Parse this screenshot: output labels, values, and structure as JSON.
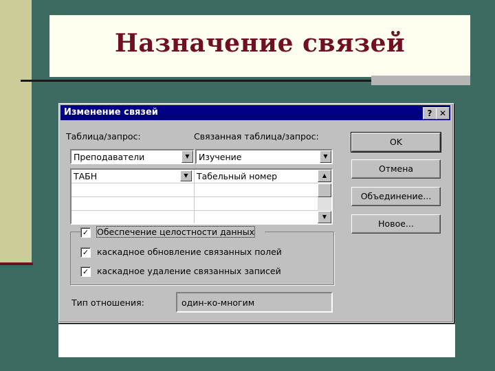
{
  "slide": {
    "title": "Назначение связей"
  },
  "dialog": {
    "title": "Изменение связей",
    "help_button": "?",
    "close_button": "✕",
    "table_label": "Таблица/запрос:",
    "related_table_label": "Связанная таблица/запрос:",
    "table_value": "Преподаватели",
    "related_table_value": "Изучение",
    "field_rows": [
      {
        "left": "ТАБН",
        "right": "Табельный номер"
      },
      {
        "left": "",
        "right": ""
      },
      {
        "left": "",
        "right": ""
      },
      {
        "left": "",
        "right": ""
      }
    ],
    "checkboxes": {
      "integrity": {
        "label": "Обеспечение целостности данных",
        "checked": true
      },
      "cascade_update": {
        "label": "каскадное обновление связанных полей",
        "checked": true
      },
      "cascade_delete": {
        "label": "каскадное удаление связанных записей",
        "checked": true
      }
    },
    "relationship_type_label": "Тип отношения:",
    "relationship_type_value": "один-ко-многим",
    "buttons": {
      "ok": "OK",
      "cancel": "Отмена",
      "join": "Объединение...",
      "new": "Новое..."
    }
  },
  "colors": {
    "background": "#3d6b61",
    "title_text": "#6e0f24",
    "accent_stripe": "#cccc99",
    "titlebar": "#000080",
    "dialog_face": "#c0c0c0"
  },
  "icons": {
    "dropdown": "triangle-down",
    "scroll_up": "triangle-up",
    "scroll_down": "triangle-down",
    "check": "check-mark"
  }
}
